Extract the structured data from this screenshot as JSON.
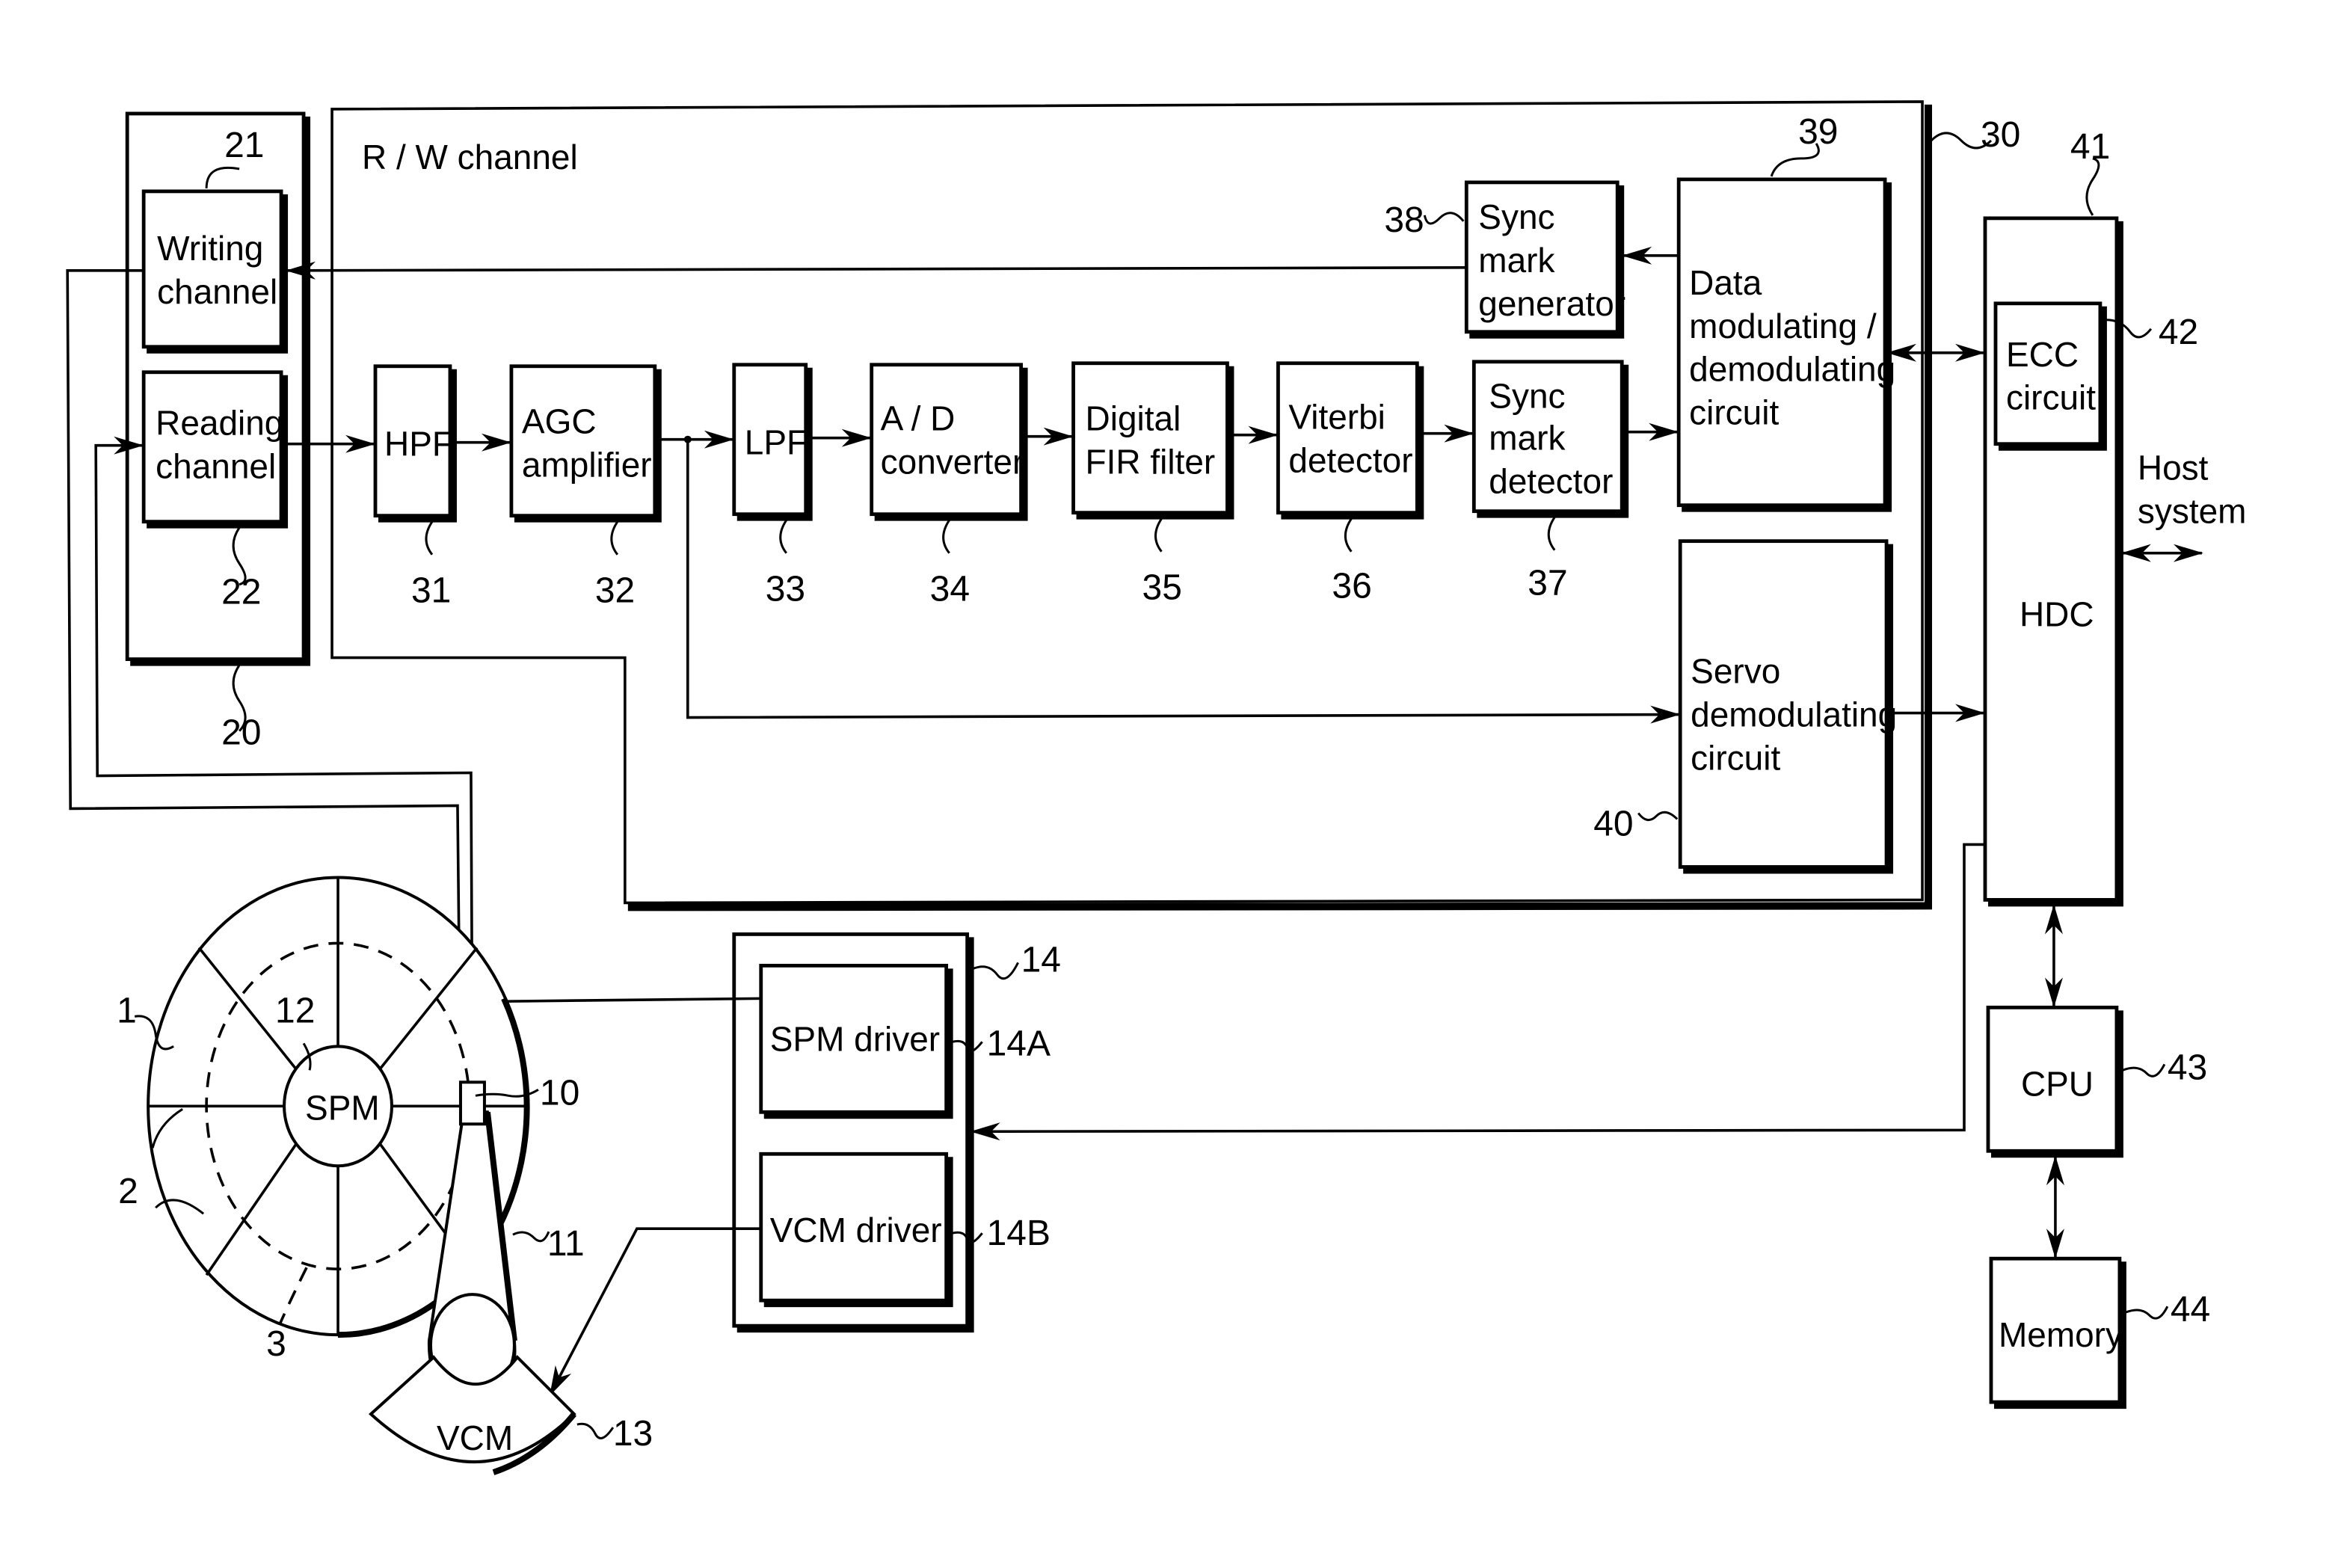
{
  "diagram": {
    "title": "R / W channel",
    "rw_channel_ref": "30",
    "head_ic": {
      "ref": "20",
      "writing_channel": {
        "ref": "21",
        "lines": [
          "Writing",
          "channel"
        ]
      },
      "reading_channel": {
        "ref": "22",
        "lines": [
          "Reading",
          "channel"
        ]
      }
    },
    "read_path": [
      {
        "ref": "31",
        "lines": [
          "HPF"
        ]
      },
      {
        "ref": "32",
        "lines": [
          "AGC",
          "amplifier"
        ]
      },
      {
        "ref": "33",
        "lines": [
          "LPF"
        ]
      },
      {
        "ref": "34",
        "lines": [
          "A / D",
          "converter"
        ]
      },
      {
        "ref": "35",
        "lines": [
          "Digital",
          "FIR  filter"
        ]
      },
      {
        "ref": "36",
        "lines": [
          "Viterbi",
          "detector"
        ]
      },
      {
        "ref": "37",
        "lines": [
          "Sync",
          "mark",
          "detector"
        ]
      }
    ],
    "sync_mark_generator": {
      "ref": "38",
      "lines": [
        "Sync",
        "mark",
        "generator"
      ]
    },
    "data_mod_demod": {
      "ref": "39",
      "lines": [
        "Data",
        "modulating /",
        "demodulating",
        "circuit"
      ]
    },
    "servo_demod": {
      "ref": "40",
      "lines": [
        "Servo",
        "demodulating",
        "circuit"
      ]
    },
    "hdc": {
      "ref": "41",
      "label": "HDC"
    },
    "ecc": {
      "ref": "42",
      "lines": [
        "ECC",
        "circuit"
      ]
    },
    "host": {
      "lines": [
        "Host",
        "system"
      ]
    },
    "cpu": {
      "ref": "43",
      "label": "CPU"
    },
    "memory": {
      "ref": "44",
      "label": "Memory"
    },
    "motor_driver": {
      "ref": "14",
      "spm_driver": {
        "ref": "14A",
        "label": "SPM  driver"
      },
      "vcm_driver": {
        "ref": "14B",
        "label": "VCM  driver"
      }
    },
    "disk": {
      "disk_ref": "1",
      "servo_area_ref": "2",
      "track_ref": "3",
      "head_ref": "10",
      "actuator_ref": "11",
      "spm": {
        "ref": "12",
        "label": "SPM"
      },
      "vcm": {
        "ref": "13",
        "label": "VCM"
      }
    }
  }
}
